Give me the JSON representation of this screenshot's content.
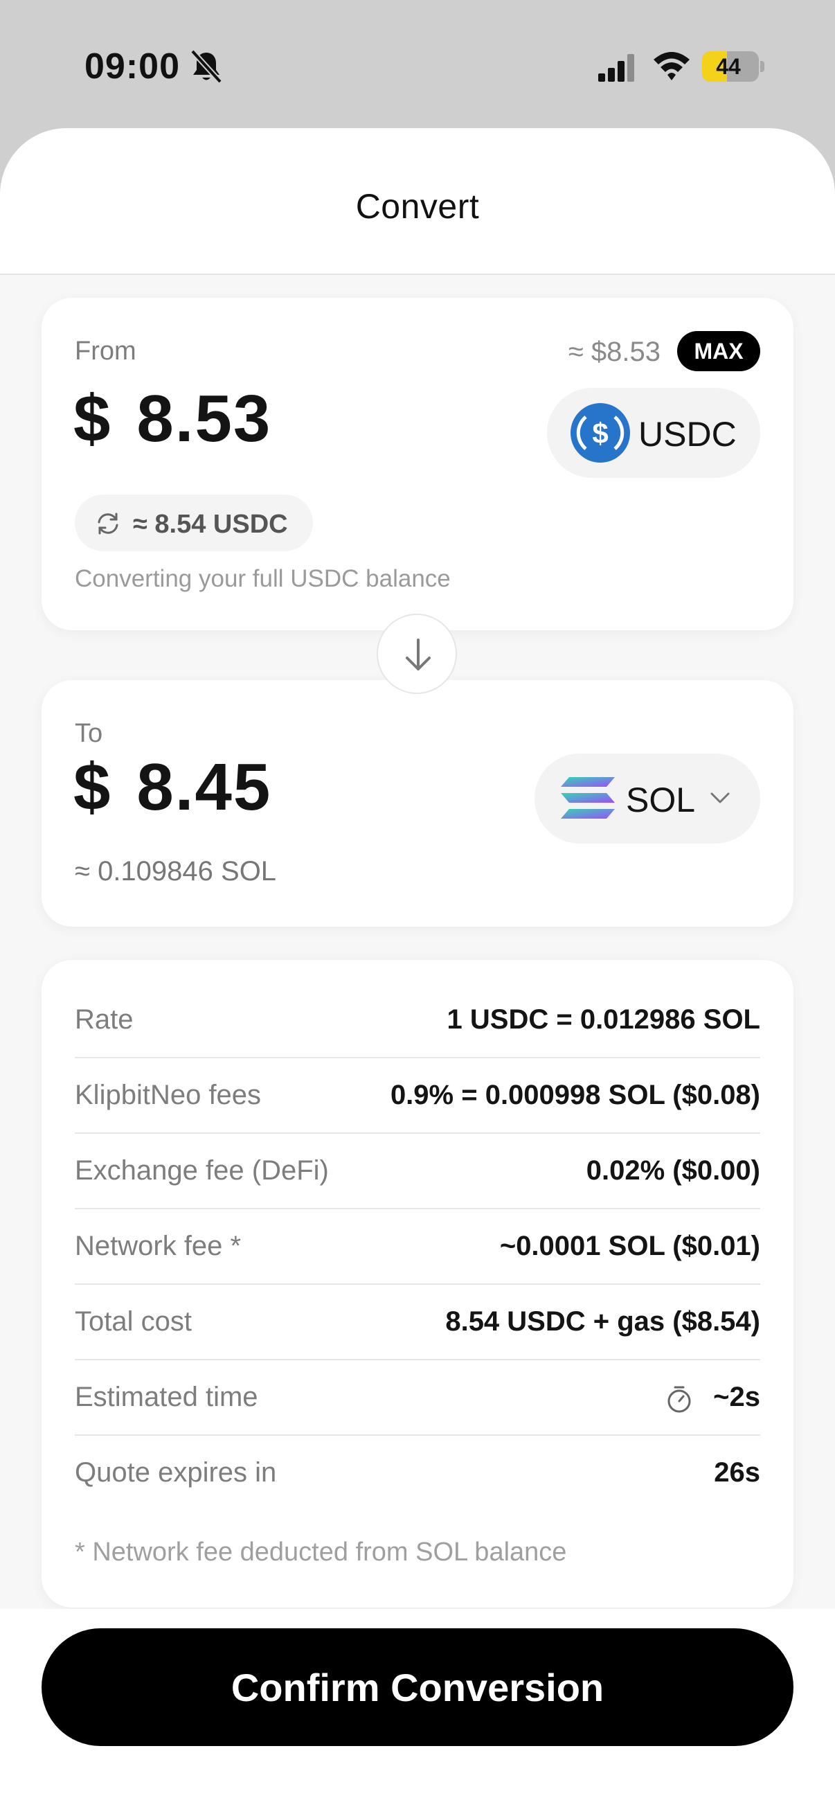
{
  "status_bar": {
    "time": "09:00",
    "battery_pct": "44",
    "battery_level": 0.44,
    "icons": [
      "bell-slash-icon",
      "cellular-signal-icon",
      "wifi-icon",
      "battery-icon"
    ]
  },
  "header": {
    "title": "Convert"
  },
  "from": {
    "label": "From",
    "approx_usd": "≈ $8.53",
    "max_label": "MAX",
    "currency_symbol": "$",
    "amount": "8.53",
    "token": "USDC",
    "token_icon": "usdc-logo-icon",
    "token_color": "#2775CA",
    "rate_chip": "≈ 8.54 USDC",
    "note": "Converting your full USDC balance"
  },
  "swap": {
    "icon": "arrow-down-icon"
  },
  "to": {
    "label": "To",
    "currency_symbol": "$",
    "amount": "8.45",
    "token": "SOL",
    "token_icon": "solana-logo-icon",
    "approx": "≈ 0.109846 SOL"
  },
  "details": {
    "rows": [
      {
        "label": "Rate",
        "value": "1 USDC = 0.012986 SOL"
      },
      {
        "label": "KlipbitNeo fees",
        "value": "0.9% = 0.000998 SOL ($0.08)"
      },
      {
        "label": "Exchange fee (DeFi)",
        "value": "0.02% ($0.00)"
      },
      {
        "label": "Network fee *",
        "value": "~0.0001 SOL ($0.01)"
      },
      {
        "label": "Total cost",
        "value": "8.54 USDC + gas ($8.54)"
      },
      {
        "label": "Estimated time",
        "value": "~2s",
        "icon": "timer-icon"
      },
      {
        "label": "Quote expires in",
        "value": "26s"
      }
    ],
    "footnote": "* Network fee deducted from SOL balance"
  },
  "confirm": {
    "label": "Confirm Conversion"
  },
  "colors": {
    "accent": "#000000",
    "battery": "#F4D21A",
    "sheet": "#FFFFFF",
    "backdrop": "#CFCFCF"
  }
}
